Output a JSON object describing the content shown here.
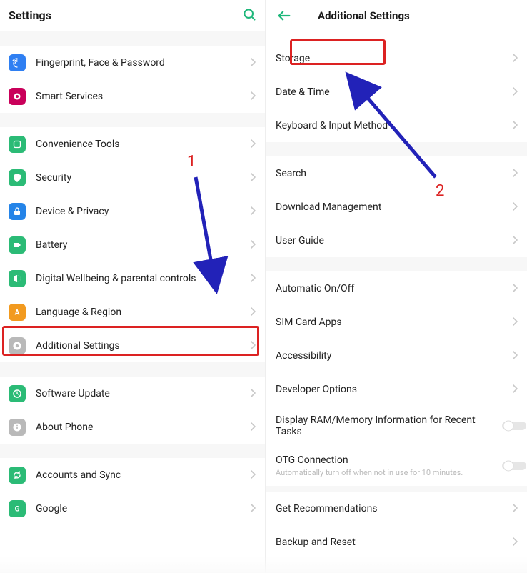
{
  "left": {
    "title": "Settings",
    "items": [
      {
        "label": "Fingerprint, Face & Password",
        "icon": "fingerprint",
        "bg": "#2f7ff2"
      },
      {
        "label": "Smart Services",
        "icon": "circle",
        "bg": "#c9005a"
      },
      {
        "label": "Convenience Tools",
        "icon": "tools",
        "bg": "#2bbb76"
      },
      {
        "label": "Security",
        "icon": "shield",
        "bg": "#2bbb76"
      },
      {
        "label": "Device & Privacy",
        "icon": "lock",
        "bg": "#2584e8"
      },
      {
        "label": "Battery",
        "icon": "battery",
        "bg": "#2bbb76"
      },
      {
        "label": "Digital Wellbeing & parental controls",
        "icon": "wellbeing",
        "bg": "#2bbb76"
      },
      {
        "label": "Language & Region",
        "icon": "language",
        "bg": "#f29a1f"
      },
      {
        "label": "Additional Settings",
        "icon": "gear",
        "bg": "#b9b9b9"
      },
      {
        "label": "Software Update",
        "icon": "update",
        "bg": "#2bbb76"
      },
      {
        "label": "About Phone",
        "icon": "about",
        "bg": "#b9b9b9"
      },
      {
        "label": "Accounts and Sync",
        "icon": "sync",
        "bg": "#2bbb76"
      },
      {
        "label": "Google",
        "icon": "g",
        "bg": "#2bbb76"
      }
    ]
  },
  "right": {
    "title": "Additional Settings",
    "groups": [
      [
        "Storage",
        "Date & Time",
        "Keyboard & Input Method"
      ],
      [
        "Search",
        "Download Management",
        "User Guide"
      ],
      [
        "Automatic On/Off",
        "SIM Card Apps",
        "Accessibility",
        "Developer Options"
      ]
    ],
    "toggleItems": [
      {
        "label": "Display RAM/Memory Information for Recent Tasks"
      },
      {
        "label": "OTG Connection",
        "sub": "Automatically turn off when not in use for 10 minutes."
      }
    ],
    "tail": [
      "Get Recommendations",
      "Backup and Reset"
    ]
  },
  "annotations": {
    "num1": "1",
    "num2": "2"
  }
}
